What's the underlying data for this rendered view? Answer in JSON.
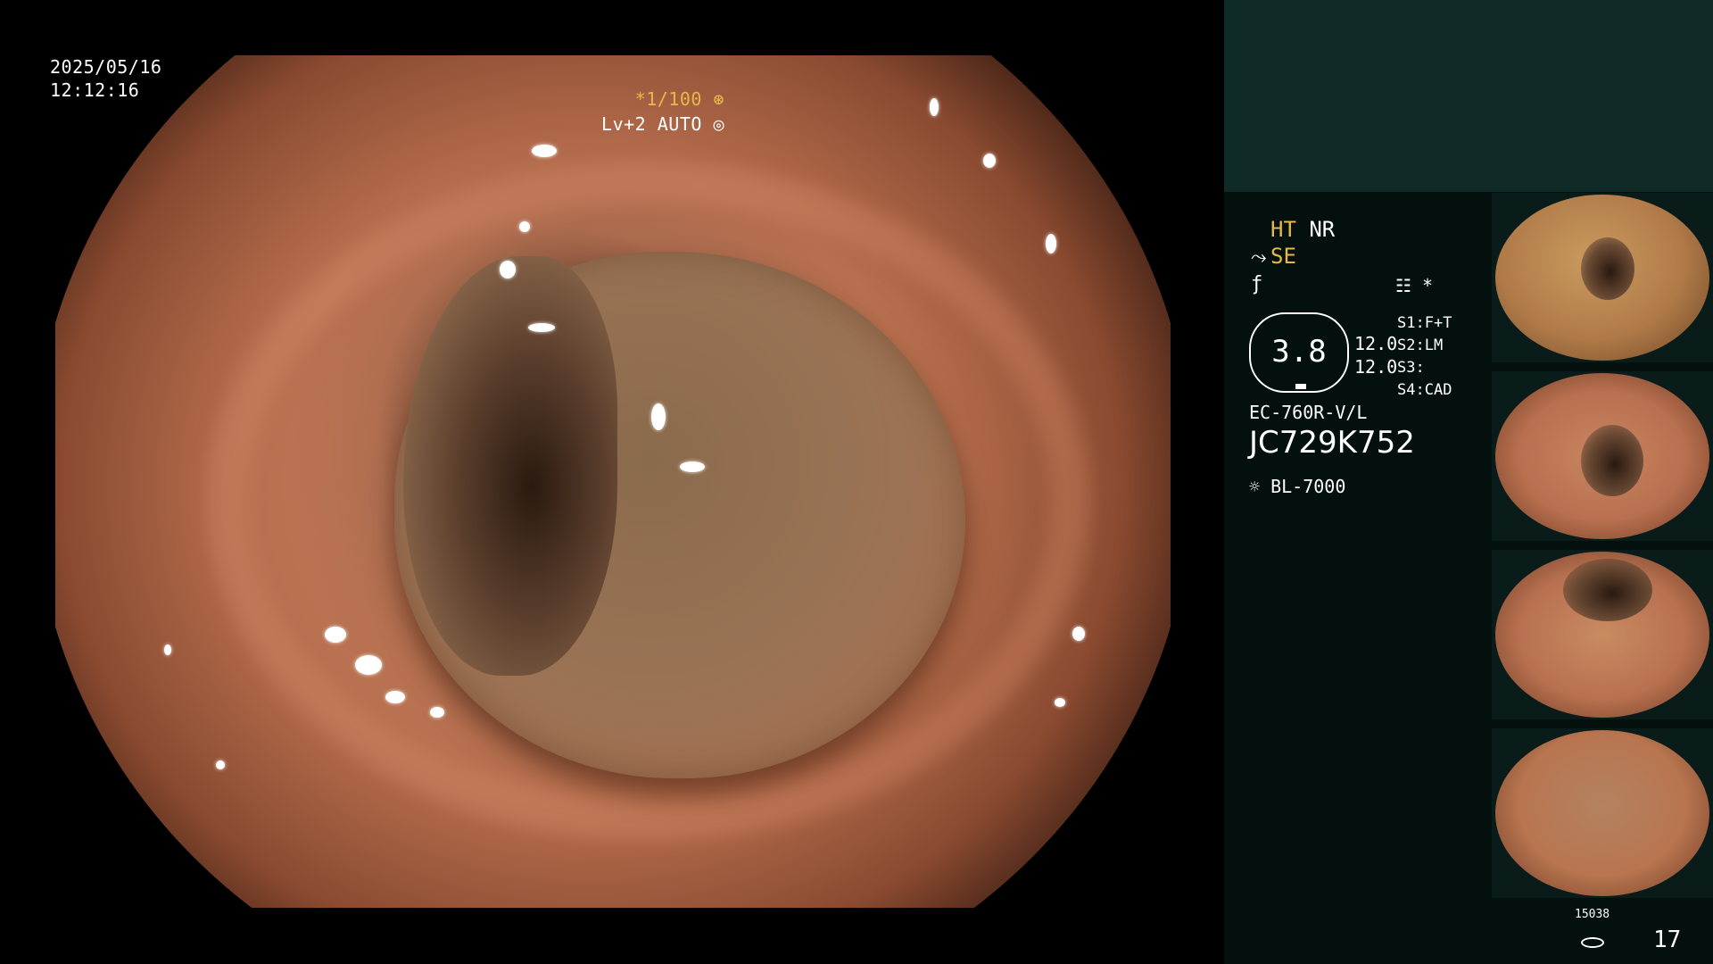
{
  "overlay": {
    "date": "2025/05/16",
    "time": "12:12:16",
    "shutter": "*1/100",
    "level": "Lv+2 AUTO"
  },
  "panel": {
    "mode_ht": "HT",
    "mode_nr": "NR",
    "mode_se": "SE",
    "enhance_icon": "enhancement-curve-icon",
    "fx_icon": "f-curve-icon",
    "menu_icon": "menu-list-icon",
    "asterisk": "*",
    "gauge_value": "3.8",
    "gauge_num_1": "12.0",
    "gauge_num_2": "12.0",
    "slots": [
      {
        "key": "S1",
        "value": "F+T"
      },
      {
        "key": "S2",
        "value": "LM"
      },
      {
        "key": "S3",
        "value": ""
      },
      {
        "key": "S4",
        "value": "CAD"
      }
    ],
    "scope_model": "EC-760R-V/L",
    "serial": "JC729K752",
    "light_source": "BL-7000",
    "light_icon": "light-source-icon"
  },
  "footer": {
    "counter": "15038",
    "disk_icon": "disk-icon",
    "image_count": "17"
  },
  "colors": {
    "accent_yellow": "#e6b84a",
    "panel_bg": "#03100e",
    "panel_top": "#0f2a27"
  }
}
